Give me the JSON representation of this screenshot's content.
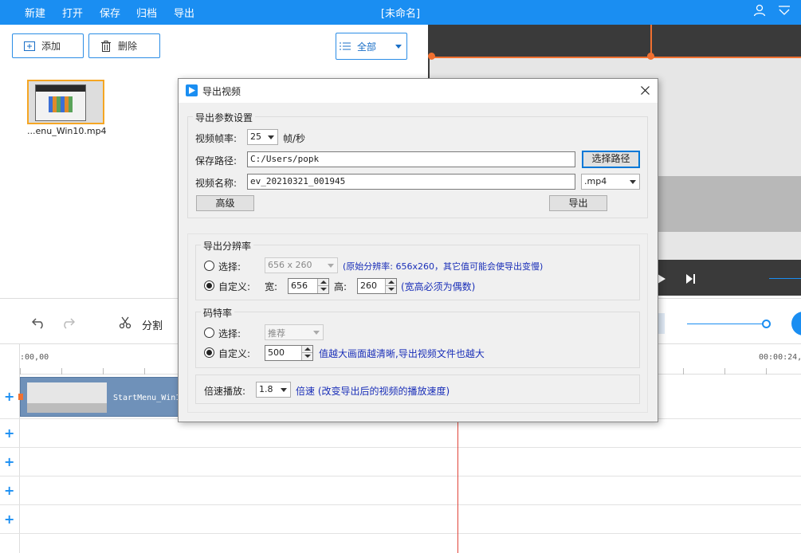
{
  "topbar": {
    "menu": [
      "新建",
      "打开",
      "保存",
      "归档",
      "导出"
    ],
    "title": "[未命名]",
    "user_icon": "user-icon",
    "dropdown_icon": "chevron-down-icon",
    "bg_color": "#1a8ef2"
  },
  "media": {
    "add_label": "添加",
    "delete_label": "删除",
    "filter_label": "全部",
    "item_name": "...enu_Win10.mp4"
  },
  "timeline": {
    "undo_icon": "undo-icon",
    "redo_icon": "redo-icon",
    "split_label": "分割",
    "ruler_start": ":00,00",
    "ruler_end": "00:00:24,",
    "clip_label": "StartMenu_Win1"
  },
  "dialog": {
    "title": "导出视频",
    "params": {
      "group_title": "导出参数设置",
      "fps_label": "视频帧率:",
      "fps_value": "25",
      "fps_unit": "帧/秒",
      "path_label": "保存路径:",
      "path_value": "C:/Users/popk",
      "browse_label": "选择路径",
      "name_label": "视频名称:",
      "name_value": "ev_20210321_001945",
      "ext_value": ".mp4",
      "advanced_label": "高级",
      "export_label": "导出"
    },
    "resolution": {
      "group_title": "导出分辨率",
      "select_label": "选择:",
      "select_value": "656 x 260",
      "select_hint": "(原始分辨率: 656x260，其它值可能会使导出变慢)",
      "custom_label": "自定义:",
      "width_label": "宽:",
      "width_value": "656",
      "height_label": "高:",
      "height_value": "260",
      "custom_hint": "(宽高必须为偶数)"
    },
    "bitrate": {
      "group_title": "码特率",
      "select_label": "选择:",
      "select_value": "推荐",
      "custom_label": "自定义:",
      "custom_value": "500",
      "hint": "值越大画面越清晰,导出视频文件也越大"
    },
    "speed": {
      "label": "倍速播放:",
      "value": "1.8",
      "hint": "倍速 (改变导出后的视频的播放速度)"
    }
  }
}
